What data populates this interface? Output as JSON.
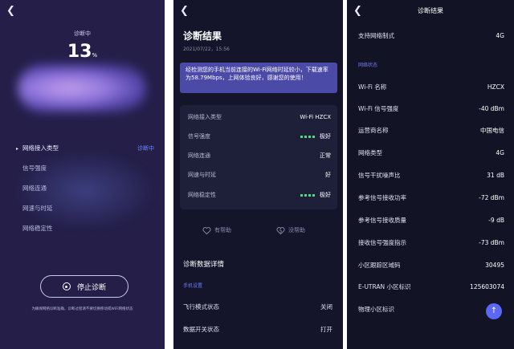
{
  "screen1": {
    "back_icon": "chevron-left-icon",
    "title": "诊断中",
    "percent_value": "13",
    "percent_unit": "%",
    "steps": [
      {
        "label": "网络接入类型",
        "status": "诊断中"
      },
      {
        "label": "信号强度",
        "status": ""
      },
      {
        "label": "网络连通",
        "status": ""
      },
      {
        "label": "网速与时延",
        "status": ""
      },
      {
        "label": "网络稳定性",
        "status": ""
      }
    ],
    "stop_button": "停止诊断",
    "notice": "为确保网络诊断准确，诊断过程请不要切换移动或WiFi网络状态"
  },
  "screen2": {
    "back_icon": "chevron-left-icon",
    "title": "诊断结果",
    "date": "2021/07/22，15:56",
    "alert": "经检测您的手机当前连接的Wi-Fi网络时延较小，下载速率为58.79Mbps，上网体验良好，感谢您的使用！",
    "rows": [
      {
        "label": "网络接入类型",
        "value": "Wi-Fi HZCX",
        "dots": false
      },
      {
        "label": "信号强度",
        "value": "极好",
        "dots": true
      },
      {
        "label": "网络连通",
        "value": "正常",
        "dots": false
      },
      {
        "label": "网速与时延",
        "value": "好",
        "dots": false
      },
      {
        "label": "网络稳定性",
        "value": "极好",
        "dots": true
      }
    ],
    "helpful": "有帮助",
    "not_helpful": "没帮助",
    "section_title": "诊断数据详情",
    "subsection": "手机设置",
    "settings": [
      {
        "label": "飞行模式状态",
        "value": "关闭"
      },
      {
        "label": "数据开关状态",
        "value": "打开"
      }
    ],
    "dot_color": "#4cdc7f"
  },
  "screen3": {
    "back_icon": "chevron-left-icon",
    "title": "诊断结果",
    "top_item": {
      "label": "支持网络制式",
      "value": "4G"
    },
    "subsection": "网络状态",
    "items": [
      {
        "label": "Wi-Fi 名称",
        "value": "HZCX"
      },
      {
        "label": "Wi-Fi 信号强度",
        "value": "-40 dBm"
      },
      {
        "label": "运营商名称",
        "value": "中国电信"
      },
      {
        "label": "网络类型",
        "value": "4G"
      },
      {
        "label": "信号干扰噪声比",
        "value": "31 dB"
      },
      {
        "label": "参考信号接收功率",
        "value": "-72 dBm"
      },
      {
        "label": "参考信号接收质量",
        "value": "-9 dB"
      },
      {
        "label": "接收信号强度指示",
        "value": "-73 dBm"
      },
      {
        "label": "小区跟踪区域码",
        "value": "30495"
      },
      {
        "label": "E-UTRAN 小区标识",
        "value": "125603074"
      },
      {
        "label": "物理小区标识",
        "value": ""
      }
    ],
    "fab_icon": "arrow-up-icon",
    "accent": "#5b68f5"
  }
}
